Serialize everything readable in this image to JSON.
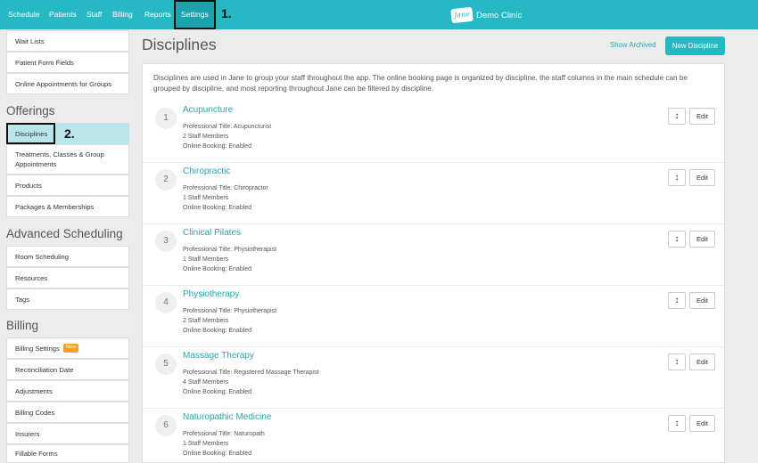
{
  "nav": {
    "items": [
      "Schedule",
      "Patients",
      "Staff",
      "Billing",
      "Reports",
      "Settings"
    ],
    "step1": "1.",
    "brand_logo": "Jane",
    "brand_name": "Demo Clinic"
  },
  "sidebar": {
    "top_items": [
      "Wait Lists",
      "Patient Form Fields",
      "Online Appointments for Groups"
    ],
    "offerings_heading": "Offerings",
    "offerings_items": [
      "Disciplines",
      "Treatments, Classes & Group Appointments",
      "Products",
      "Packages & Memberships"
    ],
    "step2": "2.",
    "advanced_heading": "Advanced Scheduling",
    "advanced_items": [
      "Room Scheduling",
      "Resources",
      "Tags"
    ],
    "billing_heading": "Billing",
    "billing_items": [
      "Billing Settings",
      "Reconciliation Date",
      "Adjustments",
      "Billing Codes",
      "Insurers",
      "Fillable Forms"
    ],
    "new_badge": "New"
  },
  "main": {
    "title": "Disciplines",
    "show_archived": "Show Archived",
    "new_discipline": "New Discipline",
    "intro": "Disciplines are used in Jane to group your staff throughout the app. The online booking page is organized by discipline, the staff columns in the main schedule can be grouped by discipline, and most reporting throughout Jane can be filtered by discipline.",
    "sort_glyph": "↕",
    "edit_label": "Edit",
    "disciplines": [
      {
        "num": "1",
        "name": "Acupuncture",
        "title": "Professional Title: Acupuncturist",
        "staff": "2 Staff Members",
        "booking": "Online Booking: Enabled"
      },
      {
        "num": "2",
        "name": "Chiropractic",
        "title": "Professional Title: Chiropractor",
        "staff": "1 Staff Members",
        "booking": "Online Booking: Enabled"
      },
      {
        "num": "3",
        "name": "Clinical Pilates",
        "title": "Professional Title: Physiotherapist",
        "staff": "1 Staff Members",
        "booking": "Online Booking: Enabled"
      },
      {
        "num": "4",
        "name": "Physiotherapy",
        "title": "Professional Title: Physiotherapist",
        "staff": "2 Staff Members",
        "booking": "Online Booking: Enabled"
      },
      {
        "num": "5",
        "name": "Massage Therapy",
        "title": "Professional Title: Registered Massage Therapist",
        "staff": "4 Staff Members",
        "booking": "Online Booking: Enabled"
      },
      {
        "num": "6",
        "name": "Naturopathic Medicine",
        "title": "Professional Title: Naturopath",
        "staff": "1 Staff Members",
        "booking": "Online Booking: Enabled"
      }
    ]
  },
  "colors": {
    "accent": "#26b8c4",
    "active_row": "#b9e6ea",
    "badge": "#f6a21d"
  }
}
